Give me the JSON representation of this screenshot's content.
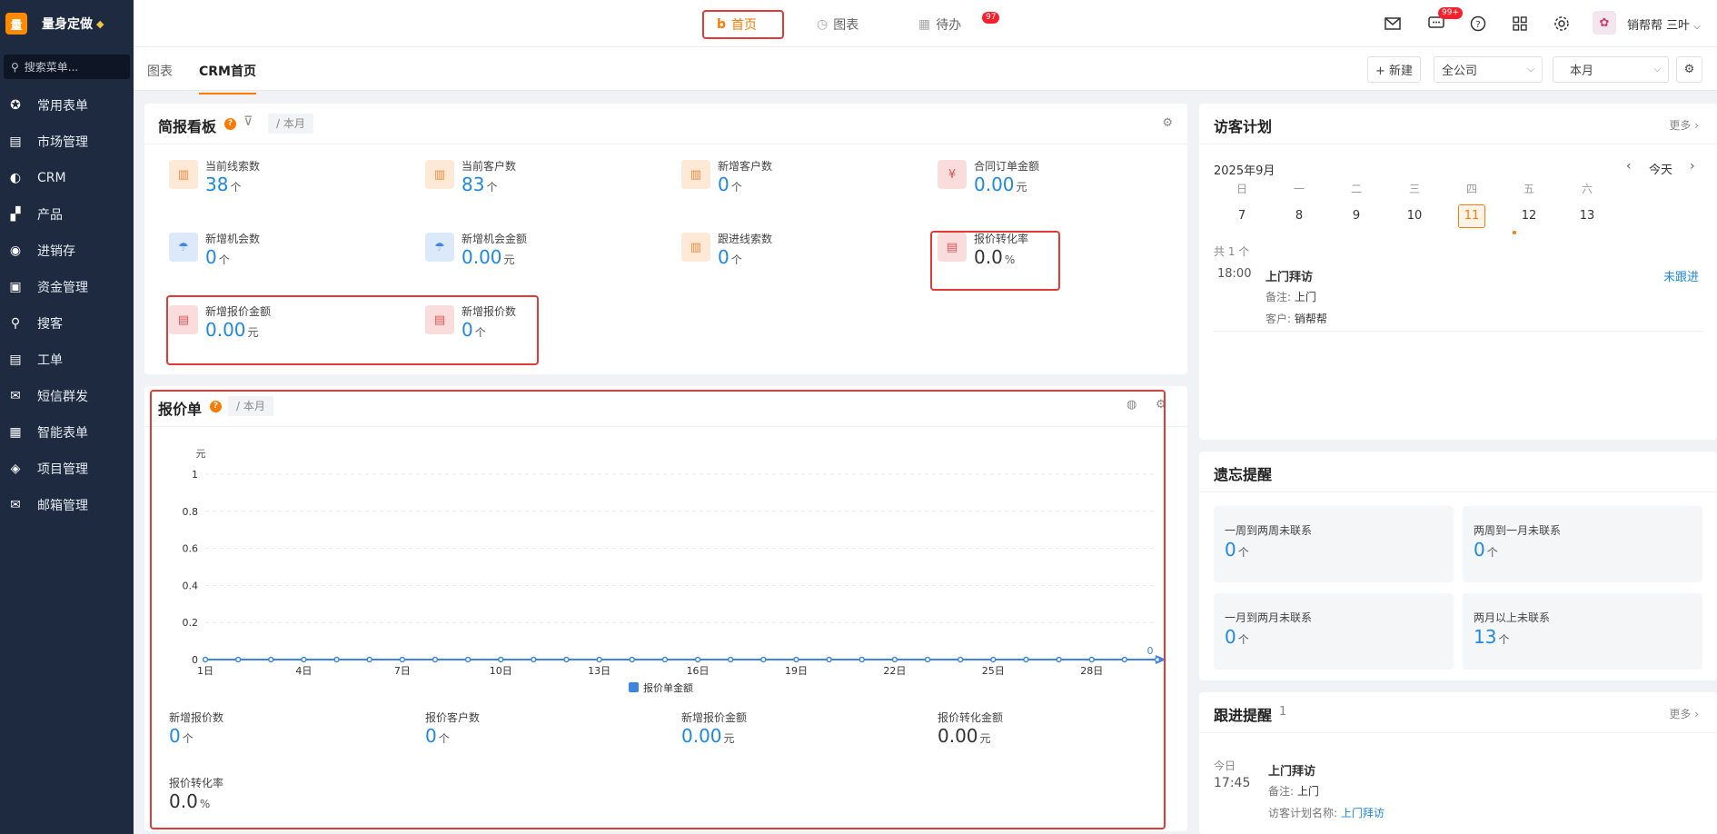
{
  "sidebar": {
    "logo_char": "量",
    "brand": "量身定做",
    "search_placeholder": "搜索菜单...",
    "items": [
      {
        "label": "常用表单",
        "icon": "star-icon"
      },
      {
        "label": "市场管理",
        "icon": "clipboard-icon"
      },
      {
        "label": "CRM",
        "icon": "pie-icon"
      },
      {
        "label": "产品",
        "icon": "product-icon"
      },
      {
        "label": "进销存",
        "icon": "inventory-icon"
      },
      {
        "label": "资金管理",
        "icon": "finance-icon"
      },
      {
        "label": "搜客",
        "icon": "search-icon"
      },
      {
        "label": "工单",
        "icon": "ticket-icon"
      },
      {
        "label": "短信群发",
        "icon": "mail-icon"
      },
      {
        "label": "智能表单",
        "icon": "form-icon"
      },
      {
        "label": "项目管理",
        "icon": "layers-icon"
      },
      {
        "label": "邮箱管理",
        "icon": "envelope-icon"
      }
    ]
  },
  "topbar": {
    "tabs": [
      {
        "label": "首页",
        "active": true
      },
      {
        "label": "图表",
        "active": false
      },
      {
        "label": "待办",
        "active": false,
        "badge": "97"
      }
    ],
    "chat_badge": "99+",
    "user_name": "销帮帮 三叶"
  },
  "subbar": {
    "tabs": [
      "图表",
      "CRM首页"
    ],
    "new_button": "+ 新建",
    "scope_select": "全公司",
    "period_select": "本月"
  },
  "briefing": {
    "title": "简报看板",
    "period": "/ 本月",
    "stats": [
      {
        "label": "当前线索数",
        "value": "38",
        "unit": "个",
        "color": "orange"
      },
      {
        "label": "当前客户数",
        "value": "83",
        "unit": "个",
        "color": "orange"
      },
      {
        "label": "新增客户数",
        "value": "0",
        "unit": "个",
        "color": "orange"
      },
      {
        "label": "合同订单金额",
        "value": "0.00",
        "unit": "元",
        "color": "red"
      },
      {
        "label": "新增机会数",
        "value": "0",
        "unit": "个",
        "color": "blue"
      },
      {
        "label": "新增机会金额",
        "value": "0.00",
        "unit": "元",
        "color": "blue"
      },
      {
        "label": "跟进线索数",
        "value": "0",
        "unit": "个",
        "color": "orange"
      },
      {
        "label": "报价转化率",
        "value": "0.0",
        "unit": "%",
        "color": "red"
      },
      {
        "label": "新增报价金额",
        "value": "0.00",
        "unit": "元",
        "color": "red"
      },
      {
        "label": "新增报价数",
        "value": "0",
        "unit": "个",
        "color": "red"
      }
    ]
  },
  "quote": {
    "title": "报价单",
    "period": "/ 本月",
    "stats": [
      {
        "label": "新增报价数",
        "value": "0",
        "unit": "个"
      },
      {
        "label": "报价客户数",
        "value": "0",
        "unit": "个"
      },
      {
        "label": "新增报价金额",
        "value": "0.00",
        "unit": "元"
      },
      {
        "label": "报价转化金额",
        "value": "0.00",
        "unit": "元"
      },
      {
        "label": "报价转化率",
        "value": "0.0",
        "unit": "%"
      }
    ]
  },
  "chart_data": {
    "type": "line",
    "ylabel": "元",
    "ylim": [
      0,
      1
    ],
    "yticks": [
      "0",
      "0.2",
      "0.4",
      "0.6",
      "0.8",
      "1"
    ],
    "x": [
      "1日",
      "2日",
      "3日",
      "4日",
      "5日",
      "6日",
      "7日",
      "8日",
      "9日",
      "10日",
      "11日",
      "12日",
      "13日",
      "14日",
      "15日",
      "16日",
      "17日",
      "18日",
      "19日",
      "20日",
      "21日",
      "22日",
      "23日",
      "24日",
      "25日",
      "26日",
      "27日",
      "28日",
      "29日",
      "30日"
    ],
    "xticks": [
      "1日",
      "4日",
      "7日",
      "10日",
      "13日",
      "16日",
      "19日",
      "22日",
      "25日",
      "28日"
    ],
    "series": [
      {
        "name": "报价单金额",
        "values": [
          0,
          0,
          0,
          0,
          0,
          0,
          0,
          0,
          0,
          0,
          0,
          0,
          0,
          0,
          0,
          0,
          0,
          0,
          0,
          0,
          0,
          0,
          0,
          0,
          0,
          0,
          0,
          0,
          0,
          0
        ],
        "color": "#3d85e0"
      }
    ],
    "last_label": "0",
    "grid": true,
    "legend": "bottom"
  },
  "visit": {
    "title": "访客计划",
    "more": "更多",
    "month": "2025年9月",
    "today_btn": "今天",
    "weekdays": [
      "日",
      "一",
      "二",
      "三",
      "四",
      "五",
      "六"
    ],
    "days": [
      "7",
      "8",
      "9",
      "10",
      "11",
      "12",
      "13"
    ],
    "count": "共 1 个",
    "event": {
      "time": "18:00",
      "title": "上门拜访",
      "status": "未跟进",
      "note_label": "备注:",
      "note": "上门",
      "customer_label": "客户:",
      "customer": "销帮帮"
    }
  },
  "forget": {
    "title": "遗忘提醒",
    "boxes": [
      {
        "label": "一周到两周未联系",
        "value": "0",
        "unit": "个"
      },
      {
        "label": "两周到一月未联系",
        "value": "0",
        "unit": "个"
      },
      {
        "label": "一月到两月未联系",
        "value": "0",
        "unit": "个"
      },
      {
        "label": "两月以上未联系",
        "value": "13",
        "unit": "个"
      }
    ]
  },
  "follow": {
    "title": "跟进提醒",
    "count": "1",
    "more": "更多",
    "day": "今日",
    "time": "17:45",
    "item_title": "上门拜访",
    "note_label": "备注:",
    "note": "上门",
    "plan_label": "访客计划名称:",
    "plan": "上门拜访"
  }
}
